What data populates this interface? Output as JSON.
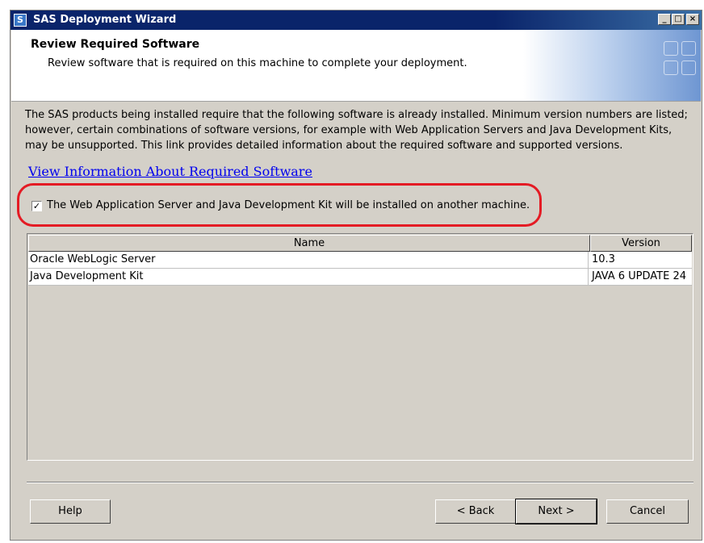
{
  "window": {
    "title": "SAS Deployment Wizard",
    "app_icon": "S",
    "controls": {
      "minimize": "_",
      "maximize": "□",
      "close": "×"
    }
  },
  "header": {
    "title": "Review Required Software",
    "subtitle": "Review software that is required on this machine to complete your deployment."
  },
  "description": "The SAS products being installed require that the following software is already installed.  Minimum version numbers are listed; however, certain combinations of software versions, for example with Web Application Servers and Java Development Kits, may be unsupported.  This link provides detailed information about the required software and supported versions.",
  "link_text": "View Information About Required Software",
  "checkbox": {
    "checked": true,
    "mark": "✓",
    "label": "The Web Application Server and Java Development Kit will be installed on another machine."
  },
  "highlight_color": "#e41b24",
  "table": {
    "columns": [
      "Name",
      "Version"
    ],
    "rows": [
      [
        "Oracle WebLogic Server",
        "10.3"
      ],
      [
        "Java Development Kit",
        "JAVA 6 UPDATE 24"
      ]
    ]
  },
  "buttons": {
    "help": "Help",
    "back": "< Back",
    "next": "Next >",
    "cancel": "Cancel"
  }
}
